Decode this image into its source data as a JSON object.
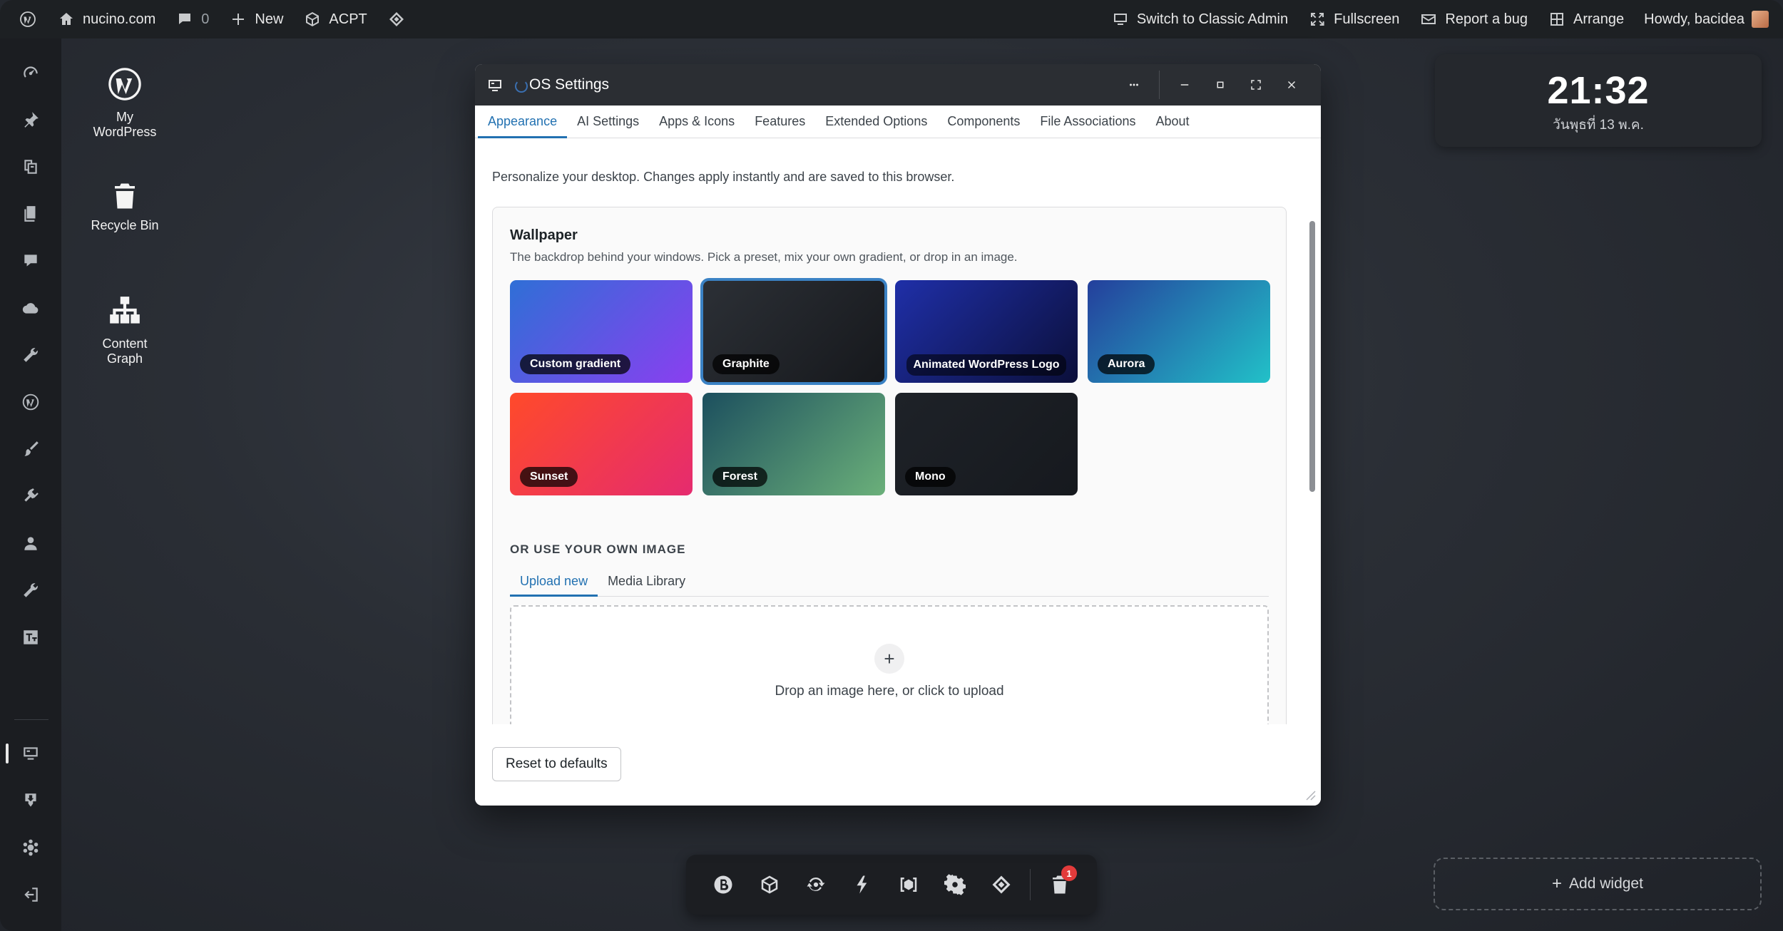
{
  "adminbar": {
    "site": "nucino.com",
    "comments_count": "0",
    "new_label": "New",
    "acpt_label": "ACPT",
    "classic_admin": "Switch to Classic Admin",
    "fullscreen": "Fullscreen",
    "report_bug": "Report a bug",
    "arrange": "Arrange",
    "howdy": "Howdy, bacidea"
  },
  "desktop_icons": [
    {
      "label": "My WordPress",
      "icon": "wordpress-icon"
    },
    {
      "label": "Recycle Bin",
      "icon": "trash-icon"
    },
    {
      "label": "Content Graph",
      "icon": "sitemap-icon"
    }
  ],
  "clock": {
    "time": "21:32",
    "date": "วันพุธที่ 13 พ.ค."
  },
  "add_widget": "Add widget",
  "dock": {
    "trash_badge": "1"
  },
  "window": {
    "title": "OS Settings",
    "tabs": [
      "Appearance",
      "AI Settings",
      "Apps & Icons",
      "Features",
      "Extended Options",
      "Components",
      "File Associations",
      "About"
    ],
    "active_tab": "Appearance",
    "intro": "Personalize your desktop. Changes apply instantly and are saved to this browser.",
    "wallpaper": {
      "heading": "Wallpaper",
      "description": "The backdrop behind your windows. Pick a preset, mix your own gradient, or drop in an image.",
      "presets": [
        {
          "label": "Custom gradient",
          "colors": [
            "#2f6fd6",
            "#8a3ff0"
          ]
        },
        {
          "label": "Graphite",
          "colors": [
            "#2c3036",
            "#16181c"
          ],
          "selected": true
        },
        {
          "label": "Animated WordPress Logo",
          "colors": [
            "#1f2fa8",
            "#0b0f3a"
          ]
        },
        {
          "label": "Aurora",
          "colors": [
            "#243f9c",
            "#22c1c8"
          ]
        },
        {
          "label": "Sunset",
          "colors": [
            "#ff4a2a",
            "#e52b6f"
          ]
        },
        {
          "label": "Forest",
          "colors": [
            "#1c4f5e",
            "#6bb07a"
          ]
        },
        {
          "label": "Mono",
          "colors": [
            "#1e2228",
            "#16191e"
          ]
        }
      ]
    },
    "own_image": {
      "heading": "OR USE YOUR OWN IMAGE",
      "tabs": [
        "Upload new",
        "Media Library"
      ],
      "dropzone_text": "Drop an image here, or click to upload"
    },
    "reset_label": "Reset to defaults"
  }
}
